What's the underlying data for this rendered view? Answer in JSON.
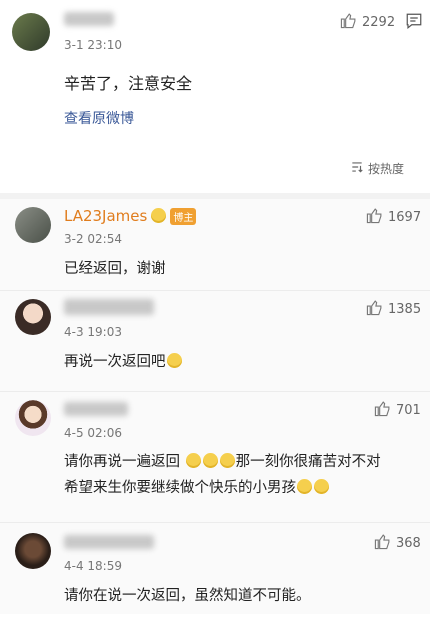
{
  "post": {
    "time": "3-1 23:10",
    "like_count": "2292",
    "text": "辛苦了，注意安全",
    "link": "查看原微博",
    "sort": "按热度"
  },
  "comments": [
    {
      "name": "LA23James",
      "badge": "博主",
      "time": "3-2 02:54",
      "likes": "1697",
      "text": "已经返回，谢谢"
    },
    {
      "name": "",
      "time": "4-3 19:03",
      "likes": "1385",
      "text": "再说一次返回吧"
    },
    {
      "name": "",
      "time": "4-5 02:06",
      "likes": "701",
      "text1": "请你再说一遍返回",
      "text2": "那一刻你很痛苦对不对",
      "text3": "希望来生你要继续做个快乐的小男孩"
    },
    {
      "name": "",
      "time": "4-4 18:59",
      "likes": "368",
      "text": "请你在说一次返回，虽然知道不可能。"
    }
  ],
  "colors": {
    "accent": "#3b5998",
    "name_orange": "#e07d1e",
    "badge": "#f0a031"
  }
}
